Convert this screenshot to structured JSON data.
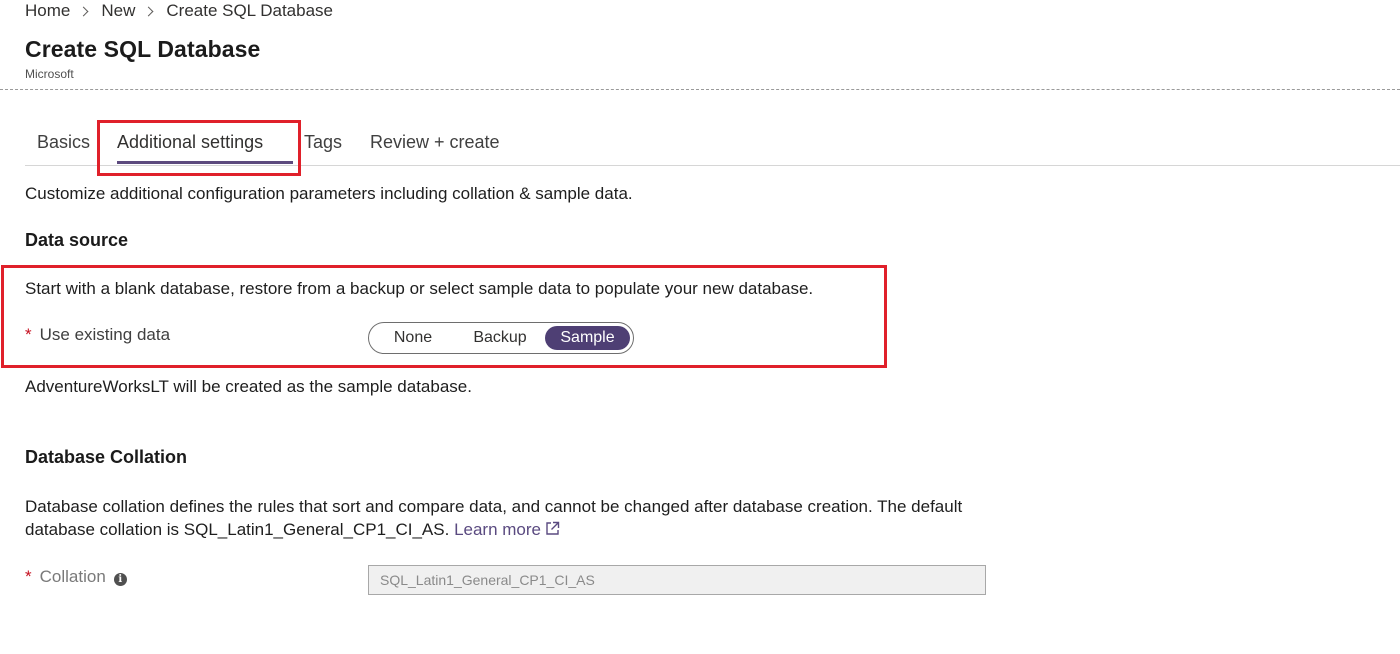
{
  "breadcrumb": {
    "items": [
      "Home",
      "New",
      "Create SQL Database"
    ]
  },
  "header": {
    "title": "Create SQL Database",
    "subtitle": "Microsoft"
  },
  "tabs": [
    {
      "label": "Basics"
    },
    {
      "label": "Additional settings",
      "active": true
    },
    {
      "label": "Tags"
    },
    {
      "label": "Review + create"
    }
  ],
  "intro": "Customize additional configuration parameters including collation & sample data.",
  "data_source": {
    "heading": "Data source",
    "description": "Start with a blank database, restore from a backup or select sample data to populate your new database.",
    "field_label": "Use existing data",
    "required_mark": "*",
    "options": [
      "None",
      "Backup",
      "Sample"
    ],
    "selected": "Sample",
    "note": "AdventureWorksLT will be created as the sample database."
  },
  "collation": {
    "heading": "Database Collation",
    "description": "Database collation defines the rules that sort and compare data, and cannot be changed after database creation. The default database collation is SQL_Latin1_General_CP1_CI_AS.",
    "learn_more": "Learn more",
    "field_label": "Collation",
    "required_mark": "*",
    "info_icon": "i",
    "value": "SQL_Latin1_General_CP1_CI_AS"
  },
  "colors": {
    "accent": "#4e3f74",
    "highlight": "#e0202a",
    "required": "#c50f1f"
  }
}
